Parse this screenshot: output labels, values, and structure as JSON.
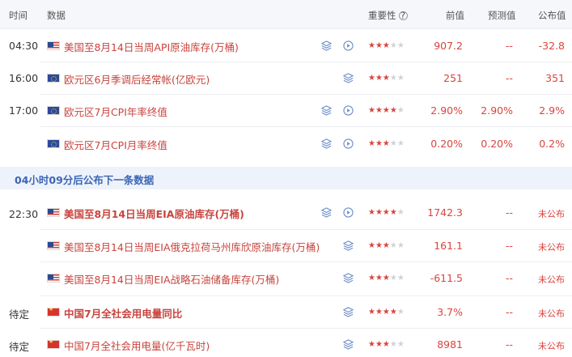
{
  "header": {
    "time": "时间",
    "data": "数据",
    "importance": "重要性",
    "help": "?",
    "previous": "前值",
    "forecast": "预测值",
    "actual": "公布值"
  },
  "notice": "04小时09分后公布下一条数据",
  "colors": {
    "accent": "#d9443e",
    "notice": "#3a66b5",
    "header_bg": "#f6f7fa"
  },
  "rows": [
    {
      "time": "04:30",
      "flag": "us-flag-icon",
      "name": "美国至8月14日当周API原油库存(万桶)",
      "stars": 3,
      "previous": "907.2",
      "forecast": "--",
      "actual": "-32.8"
    },
    {
      "time": "16:00",
      "flag": "eu-flag-icon",
      "name": "欧元区6月季调后经常帐(亿欧元)",
      "stars": 3,
      "previous": "251",
      "forecast": "--",
      "actual": "351"
    },
    {
      "time": "17:00",
      "flag": "eu-flag-icon",
      "name": "欧元区7月CPI年率终值",
      "stars": 4,
      "previous": "2.90%",
      "forecast": "2.90%",
      "actual": "2.9%"
    },
    {
      "time": "",
      "flag": "eu-flag-icon",
      "name": "欧元区7月CPI月率终值",
      "stars": 3,
      "previous": "0.20%",
      "forecast": "0.20%",
      "actual": "0.2%"
    },
    {
      "time": "22:30",
      "flag": "us-flag-icon",
      "name": "美国至8月14日当周EIA原油库存(万桶)",
      "stars": 4,
      "previous": "1742.3",
      "forecast": "--",
      "actual": "未公布"
    },
    {
      "time": "",
      "flag": "us-flag-icon",
      "name": "美国至8月14日当周EIA俄克拉荷马州库欣原油库存(万桶)",
      "stars": 3,
      "previous": "161.1",
      "forecast": "--",
      "actual": "未公布"
    },
    {
      "time": "",
      "flag": "us-flag-icon",
      "name": "美国至8月14日当周EIA战略石油储备库存(万桶)",
      "stars": 3,
      "previous": "-611.5",
      "forecast": "--",
      "actual": "未公布"
    },
    {
      "time": "待定",
      "flag": "cn-flag-icon",
      "name": "中国7月全社会用电量同比",
      "stars": 4,
      "previous": "3.7%",
      "forecast": "--",
      "actual": "未公布"
    },
    {
      "time": "待定",
      "flag": "cn-flag-icon",
      "name": "中国7月全社会用电量(亿千瓦时)",
      "stars": 3,
      "previous": "8981",
      "forecast": "--",
      "actual": "未公布"
    }
  ]
}
